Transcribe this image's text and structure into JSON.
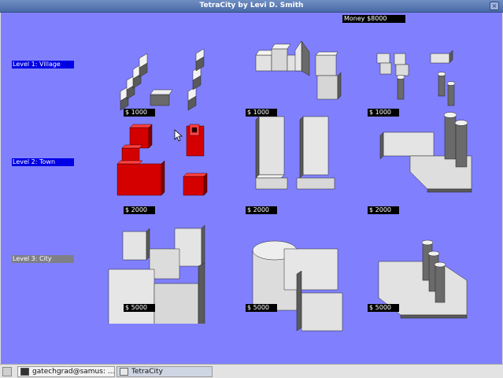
{
  "window": {
    "title": "TetraCity by Levi D. Smith",
    "close_label": "×"
  },
  "hud": {
    "money": "Money $8000"
  },
  "levels": [
    {
      "label": "Level 1: Village",
      "state": "active"
    },
    {
      "label": "Level 2: Town",
      "state": "active"
    },
    {
      "label": "Level 3: City",
      "state": "locked"
    }
  ],
  "prices": {
    "r1c1": "$ 1000",
    "r1c2": "$ 1000",
    "r1c3": "$ 1000",
    "r2c1": "$ 2000",
    "r2c2": "$ 2000",
    "r2c3": "$ 2000",
    "r3c1": "$ 5000",
    "r3c2": "$ 5000",
    "r3c3": "$ 5000"
  },
  "colors": {
    "background": "#8080fe",
    "selected_piece": "#d40000",
    "building": "#e6e6e6",
    "level_active": "#0000e6",
    "level_locked": "#7f7f88"
  },
  "taskbar": {
    "tasks": [
      {
        "label": "gatechgrad@samus: ..."
      },
      {
        "label": "TetraCity"
      }
    ]
  }
}
